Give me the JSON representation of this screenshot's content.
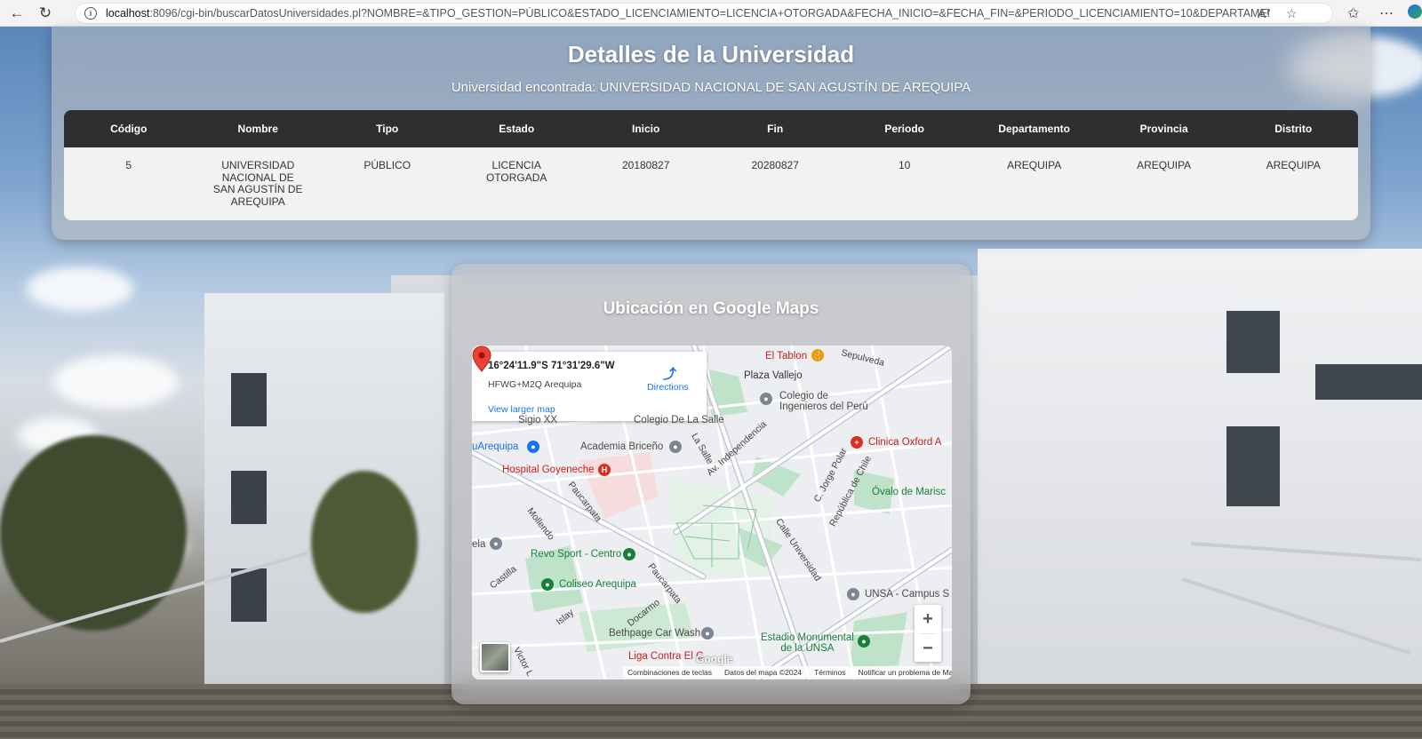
{
  "browser": {
    "url_host": "localhost",
    "url_rest": ":8096/cgi-bin/buscarDatosUniversidades.pl?NOMBRE=&TIPO_GESTION=PÚBLICO&ESTADO_LICENCIAMIENTO=LICENCIA+OTORGADA&FECHA_INICIO=&FECHA_FIN=&PERIODO_LICENCIAMIENTO=10&DEPARTAMENTO=AREQUIPA&PROVI..."
  },
  "details": {
    "title": "Detalles de la Universidad",
    "found_text": "Universidad encontrada: UNIVERSIDAD NACIONAL DE SAN AGUSTÍN DE AREQUIPA",
    "columns": [
      "Código",
      "Nombre",
      "Tipo",
      "Estado",
      "Inicio",
      "Fin",
      "Periodo",
      "Departamento",
      "Provincia",
      "Distrito"
    ],
    "row": [
      "5",
      "UNIVERSIDAD NACIONAL DE SAN AGUSTÍN DE AREQUIPA",
      "PÚBLICO",
      "LICENCIA OTORGADA",
      "20180827",
      "20280827",
      "10",
      "AREQUIPA",
      "AREQUIPA",
      "AREQUIPA"
    ]
  },
  "map_section": {
    "title": "Ubicación en Google Maps",
    "card": {
      "coords": "16°24'11.9\"S 71°31'29.6\"W",
      "plus_code": "HFWG+M2Q Arequipa",
      "larger_map": "View larger map",
      "directions": "Directions"
    },
    "labels": {
      "el_tablon": "El Tablon",
      "sepulveda": "Sepulveda",
      "plaza_vallejo": "Plaza Vallejo",
      "colegio_ingenieros": "Colegio de\nIngenieros del Perú",
      "colegio_salle": "Colegio De La Salle",
      "clinica_oxford": "Clinica Oxford A",
      "academia": "Academia Briceño",
      "uarequipa": "uArequipa",
      "hospital": "Hospital Goyeneche",
      "ovalo": "Óvalo de Marisc",
      "revo": "Revo Sport - Centro",
      "coliseo": "Coliseo Arequipa",
      "unsa_campus": "UNSA - Campus S",
      "bethpage": "Bethpage Car Wash",
      "estadio": "Estadio Monumental\nde la UNSA",
      "liga": "Liga Contra El C",
      "sigio": "Sigio XX",
      "ela": "ela",
      "street_paucarpata": "Paucarpata",
      "street_paucarpata2": "Paucarpata",
      "street_mollendo": "Mollendo",
      "street_castilla": "Castilla",
      "street_islay": "Islay",
      "street_docarmo": "Docarmo",
      "street_independencia": "Av. Independencia",
      "street_lasalle": "La Salle",
      "street_universidad": "Calle Universidad",
      "street_jorge_polar": "C. Jorge Polar",
      "street_republica": "República de Chile",
      "street_victor": "Victor L"
    },
    "attribution": [
      "Combinaciones de teclas",
      "Datos del mapa ©2024",
      "Términos",
      "Notificar un problema de Maps"
    ],
    "google_logo": "Google",
    "zoom_in": "+",
    "zoom_out": "−"
  }
}
